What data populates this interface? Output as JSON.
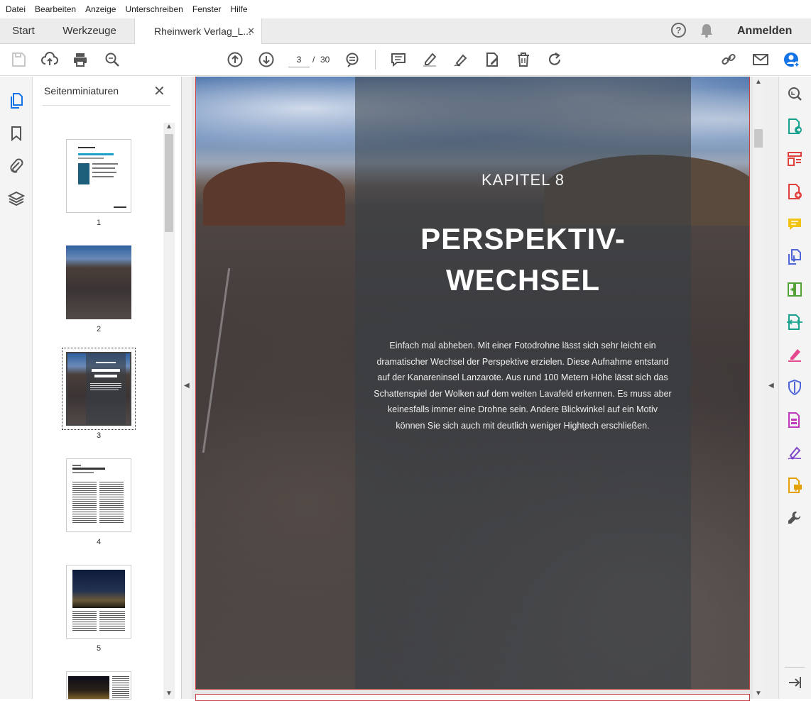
{
  "menu": [
    {
      "label": "Datei"
    },
    {
      "label": "Bearbeiten"
    },
    {
      "label": "Anzeige"
    },
    {
      "label": "Unterschreiben"
    },
    {
      "label": "Fenster"
    },
    {
      "label": "Hilfe"
    }
  ],
  "tabs": {
    "start": "Start",
    "tools": "Werkzeuge",
    "document": "Rheinwerk Verlag_L...",
    "close": "✕"
  },
  "header": {
    "help": "?",
    "login": "Anmelden"
  },
  "toolbar": {
    "current_page": "3",
    "separator": "/",
    "total_pages": "30"
  },
  "thumbnails": {
    "title": "Seitenminiaturen",
    "close": "✕",
    "pages": [
      {
        "number": "1"
      },
      {
        "number": "2"
      },
      {
        "number": "3"
      },
      {
        "number": "4"
      },
      {
        "number": "5"
      }
    ]
  },
  "document": {
    "chapter": "KAPITEL 8",
    "headline_line1": "PERSPEKTIV-",
    "headline_line2": "WECHSEL",
    "body": "Einfach mal abheben. Mit einer Fotodrohne lässt sich sehr leicht ein dramatischer Wechsel der Perspektive erzielen. Diese Aufnahme entstand auf der Kanareninsel Lanzarote. Aus rund 100 Metern Höhe lässt sich das Schattenspiel der Wolken auf dem weiten Lavafeld erkennen. Es muss aber keinesfalls immer eine Drohne sein. Andere Blickwinkel auf ein Motiv können Sie sich auch mit deutlich weniger Hightech erschließen."
  },
  "colors": {
    "accent_blue": "#1473e6",
    "page_border": "#c4423f"
  }
}
